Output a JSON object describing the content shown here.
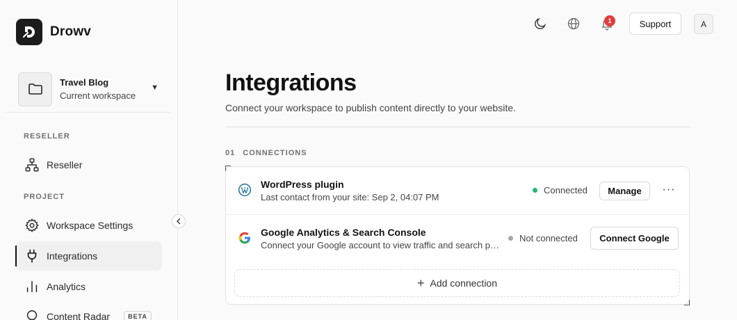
{
  "app": {
    "name": "Drowv"
  },
  "workspace": {
    "name": "Travel Blog",
    "subtitle": "Current workspace",
    "caret": "▼"
  },
  "sidebar": {
    "sections": [
      {
        "label": "RESELLER"
      },
      {
        "label": "PROJECT"
      }
    ],
    "items": [
      {
        "label": "Reseller",
        "icon": "hierarchy-icon"
      },
      {
        "label": "Workspace Settings",
        "icon": "gear-icon"
      },
      {
        "label": "Integrations",
        "icon": "plug-icon",
        "active": true
      },
      {
        "label": "Analytics",
        "icon": "bar-chart-icon"
      },
      {
        "label": "Content Radar",
        "icon": "radar-icon",
        "badge": "BETA"
      }
    ]
  },
  "topbar": {
    "notifications_count": "1",
    "support_label": "Support",
    "avatar_initial": "A"
  },
  "main": {
    "title": "Integrations",
    "subtitle": "Connect your workspace to publish content directly to your website.",
    "section_number": "01",
    "section_label": "CONNECTIONS",
    "connections": [
      {
        "title": "WordPress plugin",
        "description": "Last contact from your site: Sep 2, 04:07 PM",
        "status": "Connected",
        "status_color": "#22b573",
        "action_label": "Manage",
        "more_label": "···"
      },
      {
        "title": "Google Analytics & Search Console",
        "description": "Connect your Google account to view traffic and search performance",
        "status": "Not connected",
        "status_color": "#a8a8a8",
        "action_label": "Connect Google"
      }
    ],
    "add_connection_label": "Add connection"
  }
}
